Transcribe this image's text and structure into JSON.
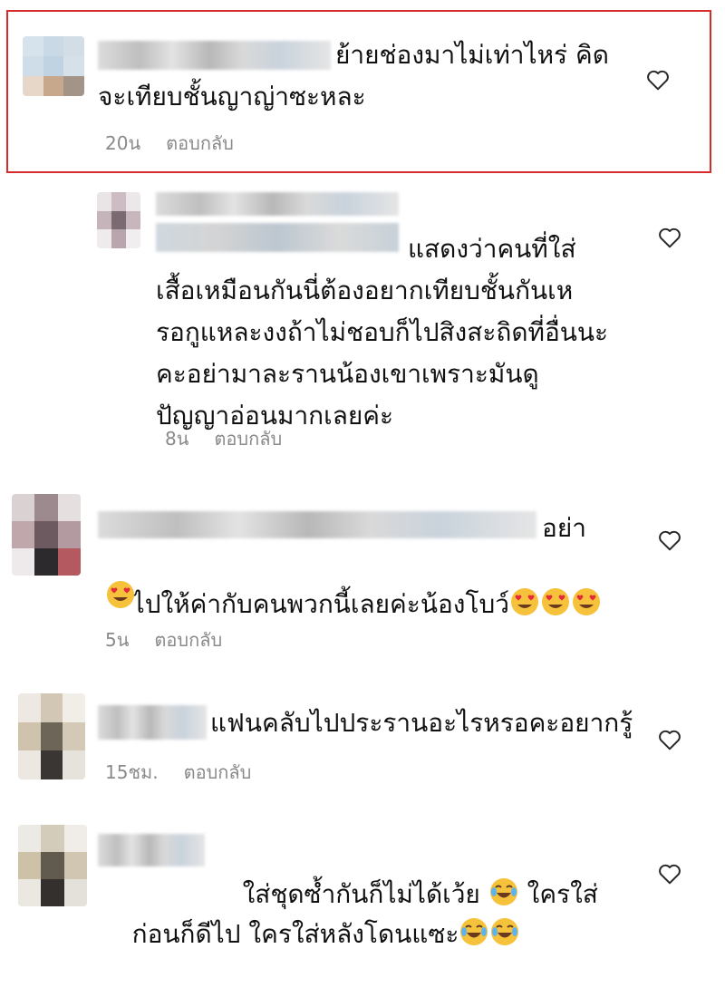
{
  "comments": [
    {
      "text": "ย้ายช่องมาไม่เท่าไหร่ คิด\nจะเทียบชั้นญาญ่าซะหละ",
      "time": "20น",
      "reply": "ตอบกลับ",
      "highlighted": true,
      "emojis": []
    },
    {
      "text": "แสดงว่าคนที่ใส่\nเสื้อเหมือนกันนี่ต้องอยากเทียบชั้นกันเห\nรอกูแหละงงถ้าไม่ชอบก็ไปสิงสะถิดที่อื่นนะ\nคะอย่ามาละรานน้องเขาเพราะมันดู\nปัญญาอ่อนมากเลยค่ะ",
      "time": "8น",
      "reply": "ตอบกลับ",
      "emojis": []
    },
    {
      "text_line1": "อย่า",
      "text_line2": "ไปให้ค่ากับคนพวกนี้เลยค่ะน้องโบว์",
      "time": "5น",
      "reply": "ตอบกลับ",
      "emojis": [
        "heart-eyes-emoji",
        "heart-eyes-emoji",
        "heart-eyes-emoji",
        "heart-eyes-emoji"
      ]
    },
    {
      "text": "แฟนคลับไปประรานอะไรหรอคะอยากรู้",
      "time": "15ชม.",
      "reply": "ตอบกลับ",
      "emojis": []
    },
    {
      "text_line1": "ใส่ชุดซ้ำกันก็ไม่ได้เว้ย",
      "text_line1b": "ใครใส่",
      "text_line2": "ก่อนก็ดีไป ใครใส่หลังโดนแซะ",
      "emojis": [
        "tears-of-joy-emoji",
        "tears-of-joy-emoji",
        "tears-of-joy-emoji"
      ]
    }
  ],
  "icons": {
    "like": "heart-outline-icon"
  },
  "colors": {
    "highlight_border": "#d62c2c",
    "meta_text": "#8a8a8a",
    "heart_stroke": "#262626"
  }
}
